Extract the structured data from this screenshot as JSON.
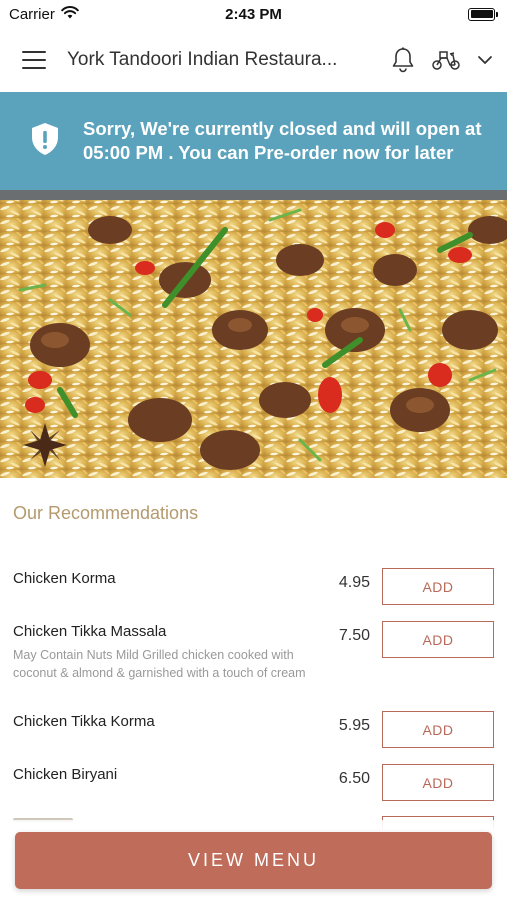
{
  "status_bar": {
    "carrier": "Carrier",
    "time": "2:43 PM",
    "battery_level": 1.0
  },
  "header": {
    "title": "York Tandoori Indian Restaura..."
  },
  "banner": {
    "message": "Sorry, We're currently closed and will open at 05:00 PM . You can Pre-order now for later"
  },
  "recommendations": {
    "title": "Our Recommendations",
    "items": [
      {
        "name": "Chicken Korma",
        "description": "",
        "price": "4.95",
        "button": "ADD"
      },
      {
        "name": "Chicken Tikka Massala",
        "description": "May Contain Nuts  Mild  Grilled chicken cooked with coconut & almond &  garnished with a touch of cream",
        "price": "7.50",
        "button": "ADD"
      },
      {
        "name": "Chicken Tikka Korma",
        "description": "",
        "price": "5.95",
        "button": "ADD"
      },
      {
        "name": "Chicken Biryani",
        "description": "",
        "price": "6.50",
        "button": "ADD"
      }
    ]
  },
  "footer": {
    "view_menu": "VIEW MENU"
  },
  "colors": {
    "banner": "#5ba3bd",
    "accent": "#c06c5a",
    "section_title": "#b49a6e"
  },
  "icons": [
    "wifi-icon",
    "battery-icon",
    "menu-icon",
    "bell-icon",
    "scooter-icon",
    "chevron-down-icon",
    "shield-icon"
  ]
}
